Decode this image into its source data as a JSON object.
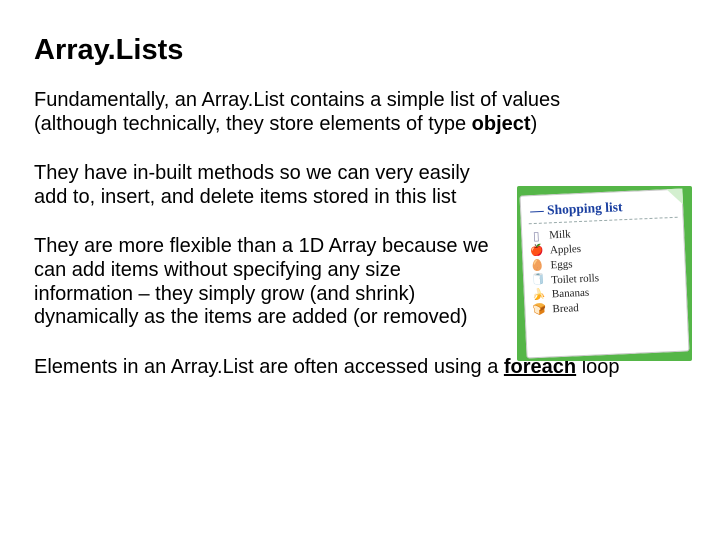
{
  "title": "Array.Lists",
  "para1_a": "Fundamentally, an Array.List contains a simple list of values",
  "para1_b": " (although technically, they store elements of type ",
  "para1_bold": "object",
  "para1_b_end": ")",
  "para2": "They have in-built methods so we can very easily add to, insert, and delete items stored in this list",
  "para3": "They are more flexible than a 1D Array because we can add items without specifying any size information – they simply grow (and shrink) dynamically as the items are added (or removed)",
  "para4_a": "Elements in an Array.List are often accessed using a ",
  "para4_bold": "foreach",
  "para4_b": "  loop",
  "shopping": {
    "title_dash": "— ",
    "title": "Shopping list",
    "items": [
      {
        "icon": "milk",
        "label": "Milk"
      },
      {
        "icon": "apple",
        "label": "Apples"
      },
      {
        "icon": "egg",
        "label": "Eggs"
      },
      {
        "icon": "toilet",
        "label": "Toilet rolls"
      },
      {
        "icon": "banana",
        "label": "Bananas"
      },
      {
        "icon": "bread",
        "label": "Bread"
      }
    ]
  }
}
